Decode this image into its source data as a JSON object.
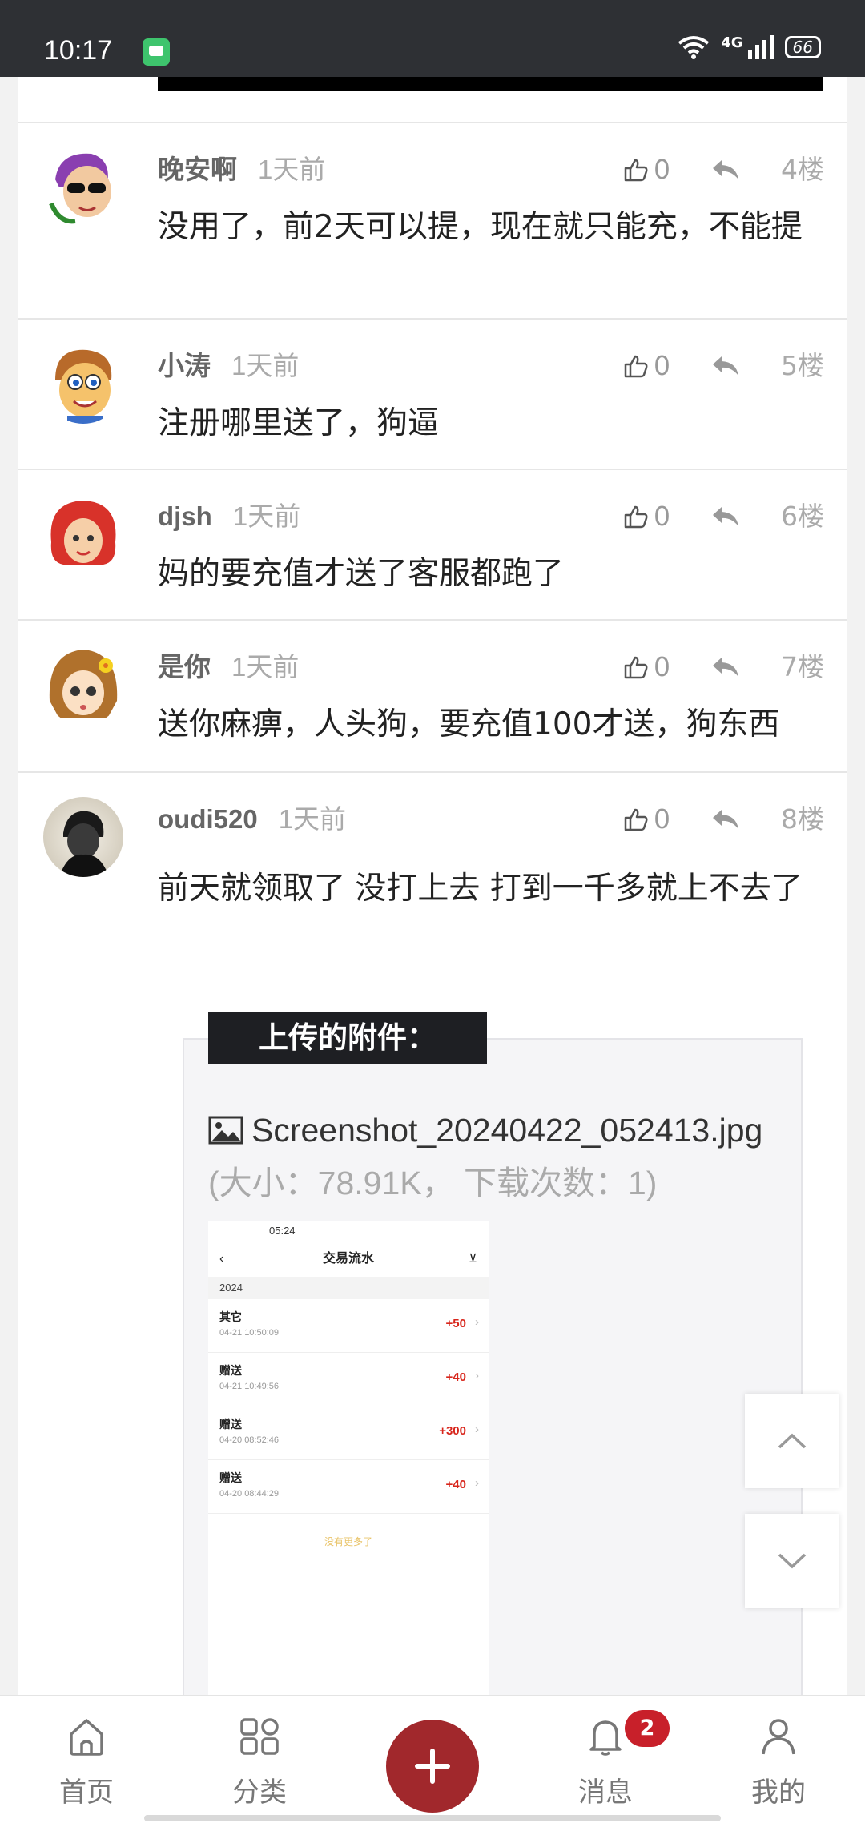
{
  "status_bar": {
    "time": "10:17",
    "network": "4G",
    "battery": "66"
  },
  "comments": [
    {
      "name": "晚安啊",
      "time": "1天前",
      "likes": "0",
      "floor": "4楼",
      "text": "没用了，前2天可以提，现在就只能充，不能提"
    },
    {
      "name": "小涛",
      "time": "1天前",
      "likes": "0",
      "floor": "5楼",
      "text": "注册哪里送了，狗逼"
    },
    {
      "name": "djsh",
      "time": "1天前",
      "likes": "0",
      "floor": "6楼",
      "text": "妈的要充值才送了客服都跑了"
    },
    {
      "name": "是你",
      "time": "1天前",
      "likes": "0",
      "floor": "7楼",
      "text": "送你麻痹，人头狗，要充值100才送，狗东西"
    },
    {
      "name": "oudi520",
      "time": "1天前",
      "likes": "0",
      "floor": "8楼",
      "text": "前天就领取了 没打上去 打到一千多就上不去了"
    }
  ],
  "attachment": {
    "title": "上传的附件：",
    "filename": "Screenshot_20240422_052413.jpg",
    "info": "(大小：78.91K， 下载次数：1)",
    "thumbnail": {
      "status_time": "05:24",
      "page_title": "交易流水",
      "year": "2024",
      "rows": [
        {
          "type": "其它",
          "date": "04-21 10:50:09",
          "amount": "+50"
        },
        {
          "type": "赠送",
          "date": "04-21 10:49:56",
          "amount": "+40"
        },
        {
          "type": "赠送",
          "date": "04-20 08:52:46",
          "amount": "+300"
        },
        {
          "type": "赠送",
          "date": "04-20 08:44:29",
          "amount": "+40"
        }
      ],
      "no_more": "没有更多了"
    }
  },
  "bottom_nav": {
    "home": "首页",
    "category": "分类",
    "messages": "消息",
    "messages_badge": "2",
    "mine": "我的"
  },
  "colors": {
    "accent": "#a1282c",
    "badge": "#c8202a",
    "amount": "#d8261c"
  }
}
